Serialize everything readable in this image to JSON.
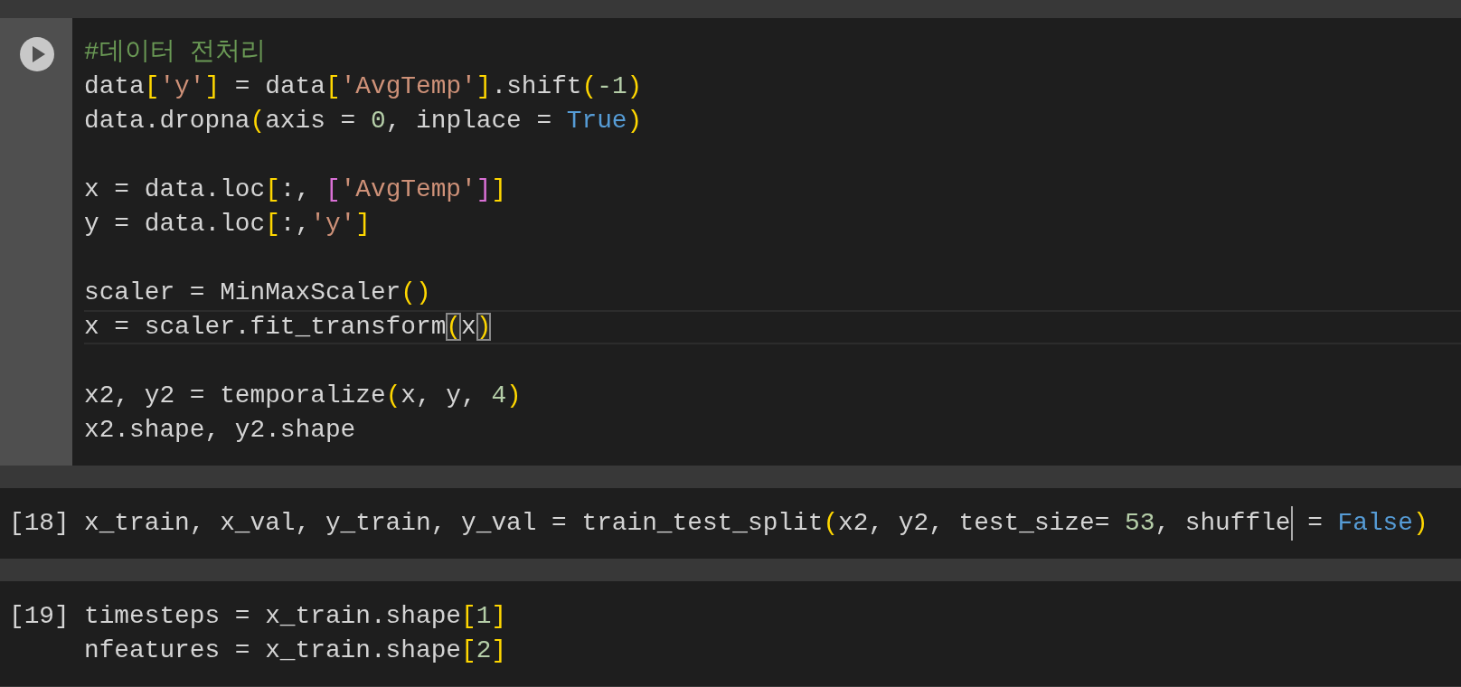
{
  "cells": [
    {
      "focused": true,
      "blocks": [
        [
          {
            "current": false,
            "tokens": [
              {
                "kind": "comment",
                "t": "#데이터 전처리"
              }
            ]
          },
          {
            "current": false,
            "tokens": [
              {
                "kind": "plain",
                "t": "data"
              },
              {
                "kind": "bracket",
                "t": "["
              },
              {
                "kind": "string",
                "t": "'y'"
              },
              {
                "kind": "bracket",
                "t": "]"
              },
              {
                "kind": "plain",
                "t": " = data"
              },
              {
                "kind": "bracket",
                "t": "["
              },
              {
                "kind": "string",
                "t": "'AvgTemp'"
              },
              {
                "kind": "bracket",
                "t": "]"
              },
              {
                "kind": "plain",
                "t": ".shift"
              },
              {
                "kind": "bracket",
                "t": "("
              },
              {
                "kind": "number",
                "t": "-1"
              },
              {
                "kind": "bracket",
                "t": ")"
              }
            ]
          },
          {
            "current": false,
            "tokens": [
              {
                "kind": "plain",
                "t": "data.dropna"
              },
              {
                "kind": "bracket",
                "t": "("
              },
              {
                "kind": "plain",
                "t": "axis = "
              },
              {
                "kind": "number",
                "t": "0"
              },
              {
                "kind": "plain",
                "t": ", inplace = "
              },
              {
                "kind": "keyword",
                "t": "True"
              },
              {
                "kind": "bracket",
                "t": ")"
              }
            ]
          }
        ],
        [
          {
            "current": false,
            "tokens": [
              {
                "kind": "plain",
                "t": "x = data.loc"
              },
              {
                "kind": "bracket",
                "t": "["
              },
              {
                "kind": "plain",
                "t": ":, "
              },
              {
                "kind": "bracket2",
                "t": "["
              },
              {
                "kind": "string",
                "t": "'AvgTemp'"
              },
              {
                "kind": "bracket2",
                "t": "]"
              },
              {
                "kind": "bracket",
                "t": "]"
              }
            ]
          },
          {
            "current": false,
            "tokens": [
              {
                "kind": "plain",
                "t": "y = data.loc"
              },
              {
                "kind": "bracket",
                "t": "["
              },
              {
                "kind": "plain",
                "t": ":,"
              },
              {
                "kind": "string",
                "t": "'y'"
              },
              {
                "kind": "bracket",
                "t": "]"
              }
            ]
          }
        ],
        [
          {
            "current": false,
            "tokens": [
              {
                "kind": "plain",
                "t": "scaler = MinMaxScaler"
              },
              {
                "kind": "bracket",
                "t": "()"
              }
            ]
          },
          {
            "current": true,
            "tokens": [
              {
                "kind": "plain",
                "t": "x = scaler.fit_transform"
              },
              {
                "kind": "matched",
                "t": "("
              },
              {
                "kind": "plain",
                "t": "x"
              },
              {
                "kind": "matched",
                "t": ")"
              }
            ]
          }
        ],
        [
          {
            "current": false,
            "tokens": [
              {
                "kind": "plain",
                "t": "x2, y2 = temporalize"
              },
              {
                "kind": "bracket",
                "t": "("
              },
              {
                "kind": "plain",
                "t": "x, y, "
              },
              {
                "kind": "number",
                "t": "4"
              },
              {
                "kind": "bracket",
                "t": ")"
              }
            ]
          },
          {
            "current": false,
            "tokens": [
              {
                "kind": "plain",
                "t": "x2.shape, y2.shape"
              }
            ]
          }
        ]
      ]
    },
    {
      "focused": false,
      "prompt": "[18]",
      "blocks": [
        [
          {
            "current": false,
            "tokens": [
              {
                "kind": "plain",
                "t": "x_train, x_val, y_train, y_val = train_test_split"
              },
              {
                "kind": "bracket",
                "t": "("
              },
              {
                "kind": "plain",
                "t": "x2, y2, test_size= "
              },
              {
                "kind": "number",
                "t": "53"
              },
              {
                "kind": "plain",
                "t": ", shuffle"
              },
              {
                "kind": "caret"
              },
              {
                "kind": "plain",
                "t": " = "
              },
              {
                "kind": "keyword",
                "t": "False"
              },
              {
                "kind": "bracket",
                "t": ")"
              }
            ]
          }
        ]
      ]
    },
    {
      "focused": false,
      "prompt": "[19]",
      "blocks": [
        [
          {
            "current": false,
            "tokens": [
              {
                "kind": "plain",
                "t": "timesteps = x_train.shape"
              },
              {
                "kind": "bracket",
                "t": "["
              },
              {
                "kind": "number",
                "t": "1"
              },
              {
                "kind": "bracket",
                "t": "]"
              }
            ]
          },
          {
            "current": false,
            "tokens": [
              {
                "kind": "plain",
                "t": "nfeatures = x_train.shape"
              },
              {
                "kind": "bracket",
                "t": "["
              },
              {
                "kind": "number",
                "t": "2"
              },
              {
                "kind": "bracket",
                "t": "]"
              }
            ]
          }
        ]
      ]
    }
  ]
}
